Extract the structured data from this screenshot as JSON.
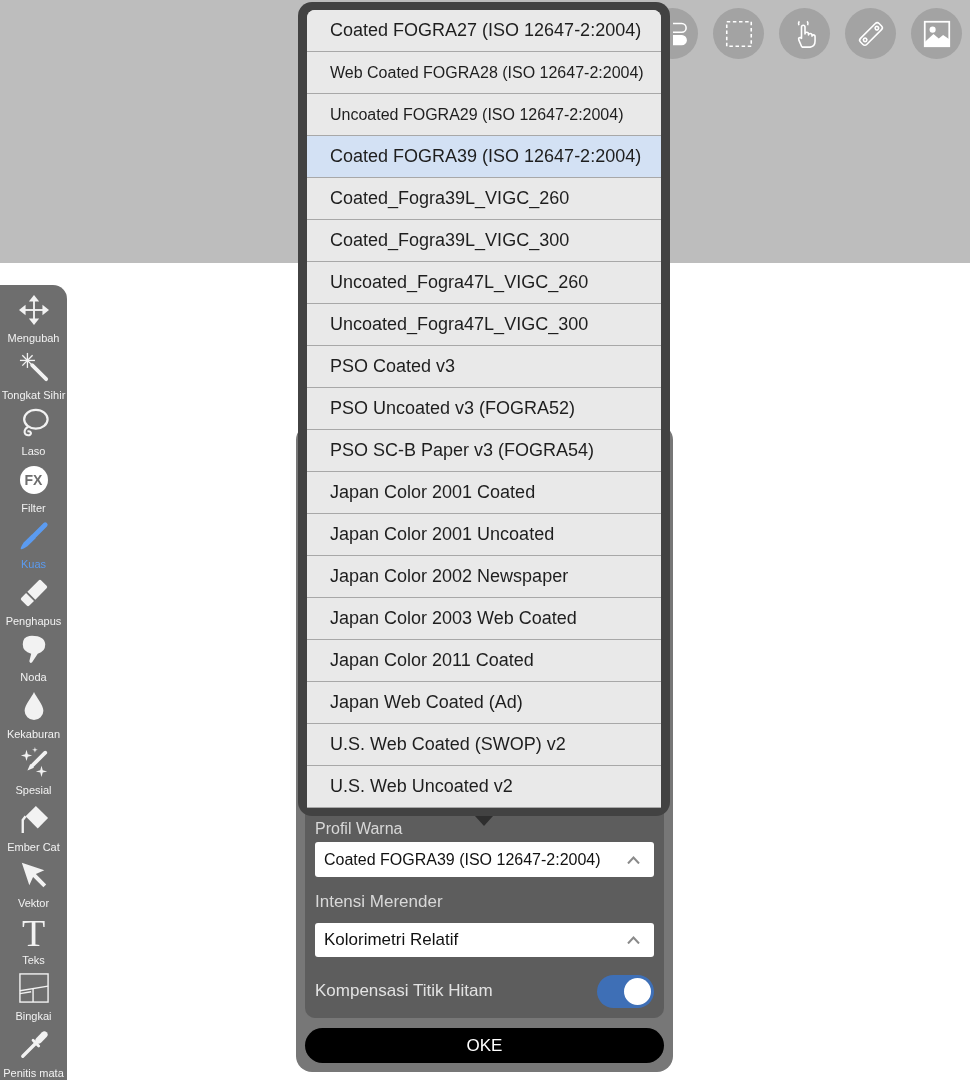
{
  "workspace": {
    "top_toolbar": [
      {
        "kind": "switches"
      },
      {
        "kind": "selection"
      },
      {
        "kind": "hand"
      },
      {
        "kind": "ruler"
      },
      {
        "kind": "image"
      }
    ]
  },
  "tools": [
    {
      "kind": "move",
      "label": "Mengubah",
      "selected": false
    },
    {
      "kind": "wand",
      "label": "Tongkat Sihir",
      "selected": false
    },
    {
      "kind": "lasso",
      "label": "Laso",
      "selected": false
    },
    {
      "kind": "filter",
      "label": "Filter",
      "glyph": "FX",
      "selected": false
    },
    {
      "kind": "brush",
      "label": "Kuas",
      "selected": true
    },
    {
      "kind": "eraser",
      "label": "Penghapus",
      "selected": false
    },
    {
      "kind": "smudge",
      "label": "Noda",
      "selected": false
    },
    {
      "kind": "blur",
      "label": "Kekaburan",
      "selected": false
    },
    {
      "kind": "special",
      "label": "Spesial",
      "selected": false
    },
    {
      "kind": "bucket",
      "label": "Ember Cat",
      "selected": false
    },
    {
      "kind": "vector",
      "label": "Vektor",
      "selected": false
    },
    {
      "kind": "text",
      "label": "Teks",
      "glyph": "T",
      "selected": false
    },
    {
      "kind": "frame",
      "label": "Bingkai",
      "selected": false
    },
    {
      "kind": "eyedropper",
      "label": "Penitis mata",
      "selected": false
    }
  ],
  "dialog": {
    "profile_label": "Profil Warna",
    "profile_value": "Coated FOGRA39 (ISO 12647-2:2004)",
    "intent_label": "Intensi Merender",
    "intent_value": "Kolorimetri Relatif",
    "black_point": {
      "label": "Kompensasi Titik Hitam",
      "on": true
    },
    "ok_button": "OKE"
  },
  "profile_menu": {
    "items": [
      {
        "label": "Coated FOGRA27 (ISO 12647-2:2004)",
        "selected": false
      },
      {
        "label": "Web Coated FOGRA28 (ISO 12647-2:2004)",
        "selected": false
      },
      {
        "label": "Uncoated FOGRA29 (ISO 12647-2:2004)",
        "selected": false
      },
      {
        "label": "Coated FOGRA39 (ISO 12647-2:2004)",
        "selected": true
      },
      {
        "label": "Coated_Fogra39L_VIGC_260",
        "selected": false
      },
      {
        "label": "Coated_Fogra39L_VIGC_300",
        "selected": false
      },
      {
        "label": "Uncoated_Fogra47L_VIGC_260",
        "selected": false
      },
      {
        "label": "Uncoated_Fogra47L_VIGC_300",
        "selected": false
      },
      {
        "label": "PSO Coated v3",
        "selected": false
      },
      {
        "label": "PSO Uncoated v3 (FOGRA52)",
        "selected": false
      },
      {
        "label": "PSO SC-B Paper v3 (FOGRA54)",
        "selected": false
      },
      {
        "label": "Japan Color 2001 Coated",
        "selected": false
      },
      {
        "label": "Japan Color 2001 Uncoated",
        "selected": false
      },
      {
        "label": "Japan Color 2002 Newspaper",
        "selected": false
      },
      {
        "label": "Japan Color 2003 Web Coated",
        "selected": false
      },
      {
        "label": "Japan Color 2011 Coated",
        "selected": false
      },
      {
        "label": "Japan Web Coated (Ad)",
        "selected": false
      },
      {
        "label": "U.S. Web Coated (SWOP) v2",
        "selected": false
      },
      {
        "label": "U.S. Web Uncoated v2",
        "selected": false
      }
    ]
  }
}
